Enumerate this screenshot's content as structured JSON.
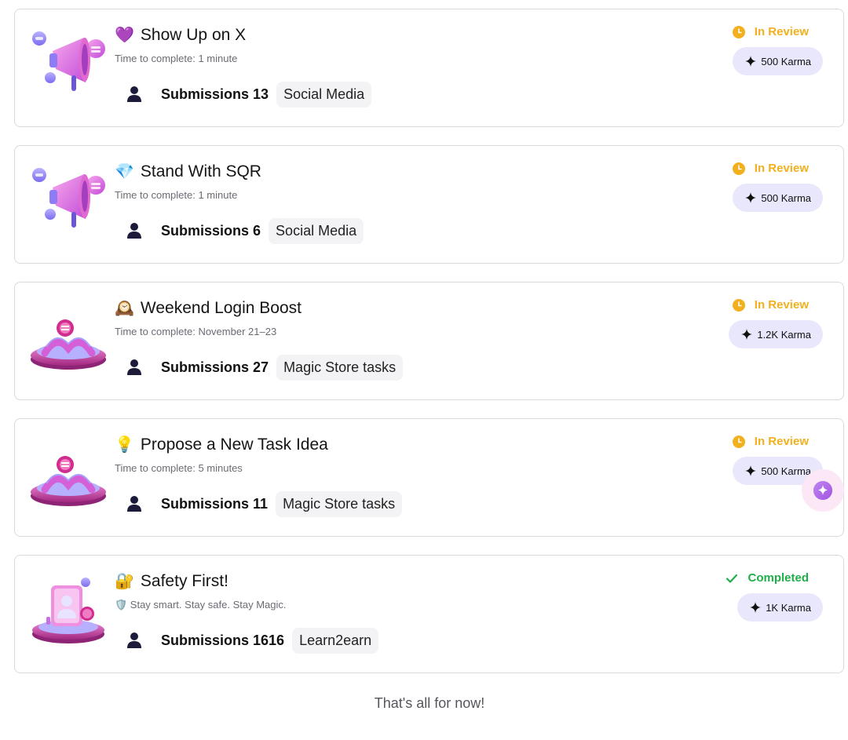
{
  "tasks": [
    {
      "emoji": "💜",
      "title": "Show Up on X",
      "subtitle": "Time to complete: 1 minute",
      "submissions": "Submissions 13",
      "tag": "Social Media",
      "status": "In Review",
      "karma": "500 Karma",
      "thumb_icon": "megaphone-icon"
    },
    {
      "emoji": "💎",
      "title": "Stand With SQR",
      "subtitle": "Time to complete: 1 minute",
      "submissions": "Submissions 6",
      "tag": "Social Media",
      "status": "In Review",
      "karma": "500 Karma",
      "thumb_icon": "megaphone-icon"
    },
    {
      "emoji": "🕰️",
      "title": "Weekend Login Boost",
      "subtitle": "Time to complete: November 21–23",
      "submissions": "Submissions 27",
      "tag": "Magic Store tasks",
      "status": "In Review",
      "karma": "1.2K Karma",
      "thumb_icon": "bridge-platform-icon"
    },
    {
      "emoji": "💡",
      "title": "Propose a New Task Idea",
      "subtitle": "Time to complete: 5 minutes",
      "submissions": "Submissions 11",
      "tag": "Magic Store tasks",
      "status": "In Review",
      "karma": "500 Karma",
      "thumb_icon": "bridge-platform-icon"
    },
    {
      "emoji": "🔐",
      "title": "Safety First!",
      "subtitle": "🛡️ Stay smart. Stay safe. Stay Magic.",
      "submissions": "Submissions 1616",
      "tag": "Learn2earn",
      "status": "Completed",
      "karma": "1K Karma",
      "thumb_icon": "profile-platform-icon"
    }
  ],
  "footer": "That's all for now!",
  "colors": {
    "review": "#f2b01e",
    "completed": "#1fae4a",
    "karma_bg": "#e8e7fb",
    "border": "#d9d9de"
  },
  "fab_icon": "ai-assistant-icon"
}
